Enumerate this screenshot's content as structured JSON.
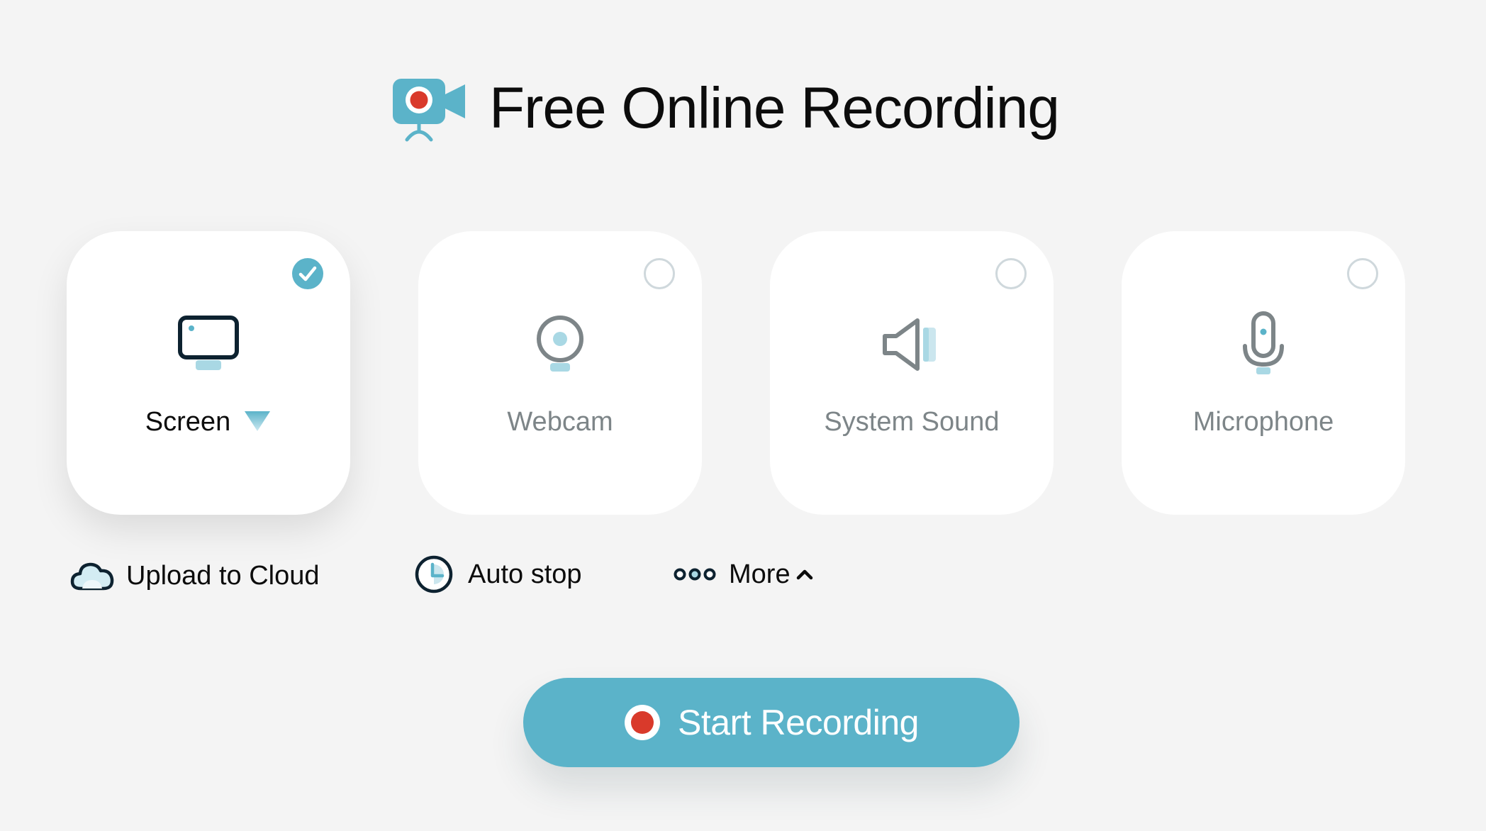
{
  "header": {
    "title": "Free Online Recording",
    "logo_icon": "camera-record-icon"
  },
  "sources": [
    {
      "label": "Screen",
      "selected": true,
      "icon": "monitor-icon"
    },
    {
      "label": "Webcam",
      "selected": false,
      "icon": "webcam-icon"
    },
    {
      "label": "System Sound",
      "selected": false,
      "icon": "speaker-icon"
    },
    {
      "label": "Microphone",
      "selected": false,
      "icon": "microphone-icon"
    }
  ],
  "options": {
    "upload_label": "Upload to Cloud",
    "autostop_label": "Auto stop",
    "more_label": "More"
  },
  "start_button": {
    "label": "Start Recording"
  },
  "colors": {
    "accent": "#5bb3c9",
    "record_red": "#d93a2b",
    "background": "#f4f4f4",
    "muted_text": "#7d8588"
  }
}
